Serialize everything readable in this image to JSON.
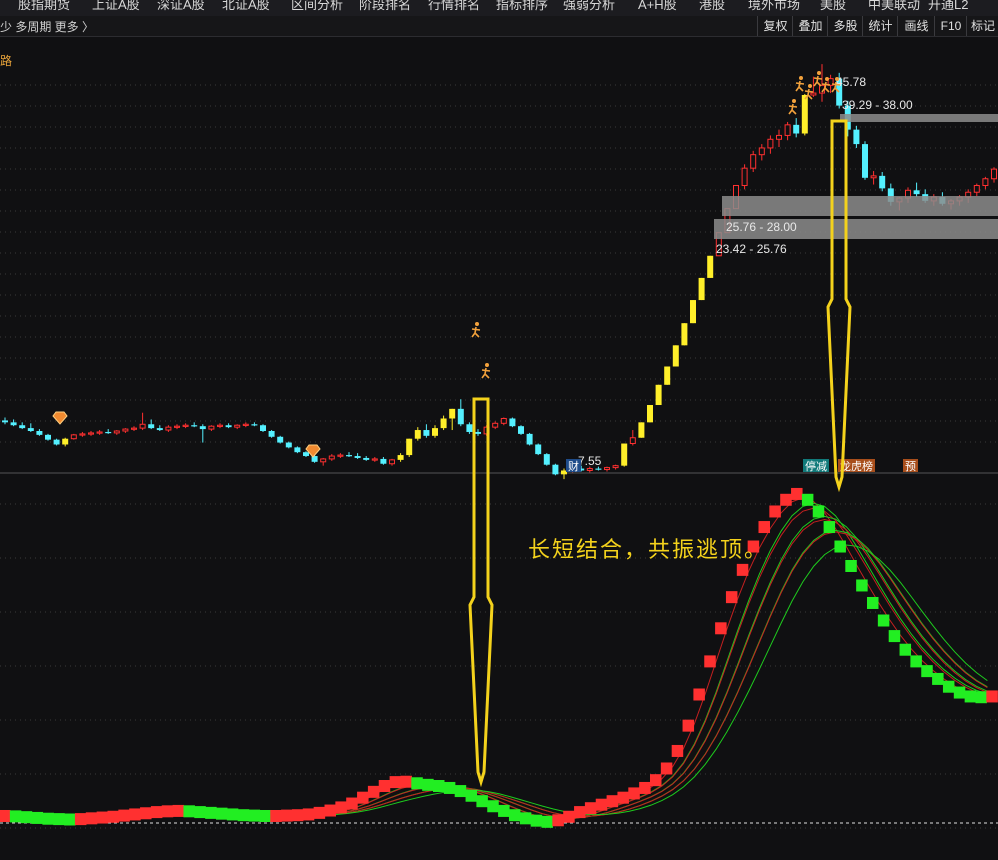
{
  "top_menu": [
    "股指期货",
    "上证A股",
    "深证A股",
    "北证A股",
    "区间分析",
    "阶段排名",
    "行情排名",
    "指标排序",
    "强弱分析",
    "A+H股",
    "港股",
    "境外市场",
    "美股",
    "中美联动",
    "开通L2"
  ],
  "toolbar": {
    "period_left": "少  多周期  更多 〉",
    "buttons": [
      "复权",
      "叠加",
      "多股",
      "统计",
      "画线",
      "F10",
      "标记"
    ]
  },
  "corner_label": "路",
  "colors": {
    "up": "#ff3030",
    "down": "#54f0ff",
    "limit": "#ffef2a",
    "green": "#22ee22",
    "annotation": "#f4d21c"
  },
  "chart_data": {
    "type": "candlestick",
    "price_labels": [
      "45.78",
      "39.29 - 38.00",
      "25.76 - 28.00",
      "23.42 - 25.76",
      "7.55"
    ],
    "event_badges": [
      "财",
      "停减",
      "龙虎榜",
      "预"
    ],
    "annotation": "长短结合，共振逃顶。",
    "ylim": [
      5,
      48
    ],
    "candles": [
      [
        8.8,
        9.1,
        8.4,
        8.6
      ],
      [
        8.6,
        8.9,
        8.2,
        8.3
      ],
      [
        8.3,
        8.6,
        7.9,
        8.0
      ],
      [
        8.0,
        8.5,
        7.6,
        7.7
      ],
      [
        7.7,
        7.9,
        7.2,
        7.3
      ],
      [
        7.3,
        7.4,
        6.7,
        6.8
      ],
      [
        6.8,
        6.9,
        6.2,
        6.3
      ],
      [
        6.3,
        7.0,
        6.1,
        6.9
      ],
      [
        6.9,
        7.4,
        6.8,
        7.3
      ],
      [
        7.3,
        7.6,
        7.1,
        7.4
      ],
      [
        7.4,
        7.7,
        7.2,
        7.5
      ],
      [
        7.5,
        7.8,
        7.3,
        7.6
      ],
      [
        7.6,
        7.9,
        7.4,
        7.5
      ],
      [
        7.5,
        7.8,
        7.3,
        7.7
      ],
      [
        7.7,
        8.0,
        7.5,
        7.9
      ],
      [
        7.9,
        8.2,
        7.7,
        8.0
      ],
      [
        8.0,
        9.6,
        7.8,
        8.4
      ],
      [
        8.4,
        8.9,
        7.9,
        8.0
      ],
      [
        8.0,
        8.3,
        7.7,
        7.8
      ],
      [
        7.8,
        8.3,
        7.6,
        8.1
      ],
      [
        8.1,
        8.4,
        7.9,
        8.2
      ],
      [
        8.2,
        8.5,
        8.0,
        8.3
      ],
      [
        8.3,
        8.6,
        8.1,
        8.2
      ],
      [
        8.2,
        8.4,
        6.5,
        7.9
      ],
      [
        7.9,
        8.3,
        7.7,
        8.2
      ],
      [
        8.2,
        8.5,
        8.0,
        8.3
      ],
      [
        8.3,
        8.5,
        8.0,
        8.1
      ],
      [
        8.1,
        8.4,
        7.9,
        8.3
      ],
      [
        8.3,
        8.6,
        8.1,
        8.4
      ],
      [
        8.4,
        8.6,
        8.2,
        8.3
      ],
      [
        8.3,
        8.4,
        7.6,
        7.7
      ],
      [
        7.7,
        7.8,
        7.0,
        7.1
      ],
      [
        7.1,
        7.2,
        6.4,
        6.5
      ],
      [
        6.5,
        6.6,
        5.9,
        6.0
      ],
      [
        6.0,
        6.1,
        5.4,
        5.5
      ],
      [
        5.5,
        5.6,
        5.0,
        5.1
      ],
      [
        5.1,
        5.2,
        4.4,
        4.5
      ],
      [
        4.5,
        4.9,
        4.1,
        4.8
      ],
      [
        4.8,
        5.3,
        4.6,
        5.1
      ],
      [
        5.1,
        5.4,
        4.9,
        5.2
      ],
      [
        5.2,
        5.5,
        5.0,
        5.1
      ],
      [
        5.1,
        5.4,
        4.8,
        4.9
      ],
      [
        4.9,
        5.1,
        4.6,
        4.7
      ],
      [
        4.7,
        5.0,
        4.5,
        4.8
      ],
      [
        4.8,
        5.0,
        4.2,
        4.3
      ],
      [
        4.3,
        4.8,
        4.1,
        4.7
      ],
      [
        4.7,
        5.4,
        4.5,
        5.2
      ],
      [
        5.2,
        6.9,
        5.0,
        6.9
      ],
      [
        6.9,
        8.1,
        6.7,
        7.8
      ],
      [
        7.8,
        8.4,
        7.0,
        7.2
      ],
      [
        7.2,
        8.3,
        7.0,
        8.0
      ],
      [
        8.0,
        9.3,
        7.8,
        9.0
      ],
      [
        9.0,
        10.0,
        7.8,
        10.0
      ],
      [
        10.0,
        11.0,
        8.2,
        8.4
      ],
      [
        8.4,
        8.6,
        7.4,
        7.6
      ],
      [
        7.6,
        7.9,
        7.2,
        7.4
      ],
      [
        7.4,
        8.3,
        7.2,
        8.1
      ],
      [
        8.1,
        8.7,
        7.9,
        8.5
      ],
      [
        8.5,
        9.1,
        8.3,
        9.0
      ],
      [
        9.0,
        9.1,
        8.1,
        8.2
      ],
      [
        8.2,
        8.3,
        7.3,
        7.4
      ],
      [
        7.4,
        7.5,
        6.2,
        6.3
      ],
      [
        6.3,
        6.4,
        5.2,
        5.3
      ],
      [
        5.3,
        5.4,
        4.1,
        4.2
      ],
      [
        4.2,
        4.3,
        3.1,
        3.2
      ],
      [
        3.2,
        3.8,
        2.7,
        3.6
      ],
      [
        3.6,
        4.2,
        3.4,
        3.8
      ],
      [
        3.8,
        4.1,
        3.5,
        3.6
      ],
      [
        3.6,
        4.0,
        3.4,
        3.8
      ],
      [
        3.8,
        4.0,
        3.6,
        3.7
      ],
      [
        3.7,
        4.0,
        3.5,
        3.9
      ],
      [
        3.9,
        4.2,
        3.7,
        4.1
      ],
      [
        4.1,
        6.4,
        4.0,
        6.4
      ],
      [
        6.4,
        7.8,
        6.2,
        7.0
      ],
      [
        7.0,
        8.6,
        7.0,
        8.6
      ],
      [
        8.6,
        10.4,
        8.6,
        10.4
      ],
      [
        10.4,
        12.5,
        10.4,
        12.5
      ],
      [
        12.5,
        14.4,
        12.5,
        14.4
      ],
      [
        14.4,
        16.6,
        14.4,
        16.6
      ],
      [
        16.6,
        18.9,
        16.6,
        18.9
      ],
      [
        18.9,
        21.3,
        18.9,
        21.3
      ],
      [
        21.3,
        23.6,
        21.3,
        23.6
      ],
      [
        23.6,
        25.9,
        23.6,
        25.9
      ],
      [
        25.9,
        28.3,
        25.9,
        28.3
      ],
      [
        28.3,
        30.8,
        28.3,
        30.8
      ],
      [
        30.8,
        33.2,
        30.8,
        33.2
      ],
      [
        33.2,
        35.4,
        32.8,
        35.0
      ],
      [
        35.0,
        36.8,
        34.6,
        36.4
      ],
      [
        36.4,
        37.5,
        35.8,
        37.1
      ],
      [
        37.1,
        38.4,
        36.5,
        38.0
      ],
      [
        38.0,
        39.0,
        37.2,
        38.4
      ],
      [
        38.4,
        39.8,
        37.9,
        39.5
      ],
      [
        39.5,
        40.2,
        38.2,
        38.6
      ],
      [
        38.6,
        42.7,
        38.4,
        42.6
      ],
      [
        42.6,
        44.5,
        42.4,
        42.8
      ],
      [
        42.8,
        45.8,
        41.9,
        43.6
      ],
      [
        43.6,
        44.7,
        42.8,
        44.3
      ],
      [
        44.3,
        44.9,
        41.2,
        41.5
      ],
      [
        41.5,
        42.0,
        38.3,
        39.0
      ],
      [
        39.0,
        39.4,
        37.1,
        37.5
      ],
      [
        37.5,
        37.8,
        33.8,
        34.0
      ],
      [
        34.0,
        34.7,
        33.3,
        34.2
      ],
      [
        34.2,
        34.6,
        32.6,
        32.9
      ],
      [
        32.9,
        33.4,
        31.1,
        31.5
      ],
      [
        31.5,
        32.0,
        30.6,
        31.9
      ],
      [
        31.9,
        33.0,
        31.4,
        32.7
      ],
      [
        32.7,
        33.5,
        32.0,
        32.3
      ],
      [
        32.3,
        32.8,
        31.4,
        31.6
      ],
      [
        31.6,
        32.3,
        31.1,
        32.0
      ],
      [
        32.0,
        32.5,
        31.1,
        31.3
      ],
      [
        31.3,
        31.8,
        30.7,
        31.6
      ],
      [
        31.6,
        32.2,
        31.1,
        32.0
      ],
      [
        32.0,
        32.8,
        31.4,
        32.5
      ],
      [
        32.5,
        33.4,
        32.1,
        33.2
      ],
      [
        33.2,
        34.1,
        32.8,
        33.9
      ],
      [
        33.9,
        35.1,
        33.5,
        34.9
      ],
      [
        34.9,
        35.7,
        34.0,
        34.3
      ]
    ],
    "oscillator": [
      1.8,
      1.7,
      1.5,
      1.3,
      1.1,
      1.0,
      0.9,
      1.0,
      1.2,
      1.4,
      1.6,
      1.9,
      2.2,
      2.5,
      2.8,
      3.0,
      3.1,
      3.0,
      2.8,
      2.6,
      2.4,
      2.2,
      2.0,
      1.9,
      1.8,
      1.8,
      1.9,
      2.0,
      2.2,
      2.6,
      3.2,
      4.0,
      5.0,
      6.5,
      8.0,
      9.5,
      10.5,
      10.6,
      10.2,
      9.8,
      9.5,
      9.0,
      8.2,
      7.0,
      5.6,
      4.3,
      3.1,
      2.0,
      1.2,
      0.6,
      0.3,
      0.7,
      1.6,
      2.8,
      3.8,
      4.7,
      5.6,
      6.5,
      7.6,
      9.0,
      11.0,
      14.0,
      18.5,
      25.0,
      33.0,
      41.5,
      50.0,
      58.0,
      65.0,
      71.0,
      76.0,
      80.0,
      83.0,
      84.5,
      83.0,
      80.0,
      76.0,
      71.0,
      66.0,
      61.0,
      56.5,
      52.0,
      48.0,
      44.5,
      41.5,
      39.0,
      37.0,
      35.0,
      33.5,
      32.5,
      32.3,
      32.5
    ]
  }
}
